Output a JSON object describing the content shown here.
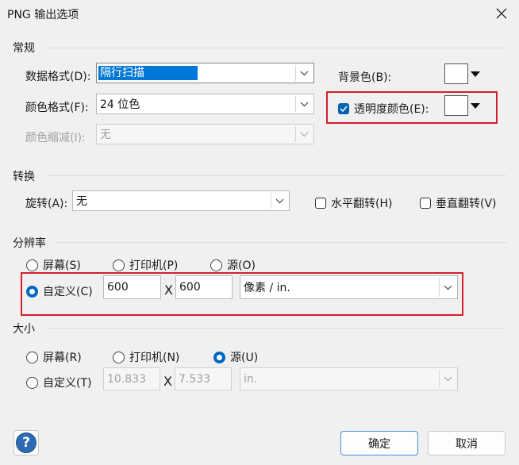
{
  "window": {
    "title": "PNG 输出选项"
  },
  "general": {
    "section": "常规",
    "data_format": {
      "label": "数据格式(D):",
      "value": "隔行扫描"
    },
    "color_format": {
      "label": "颜色格式(F):",
      "value": "24 位色"
    },
    "color_reduce": {
      "label": "颜色缩减(I):",
      "value": "无"
    },
    "background": {
      "label": "背景色(B):",
      "color": "#ffffff"
    },
    "transparent": {
      "label": "透明度颜色(E):",
      "checked": true,
      "color": "#ffffff"
    }
  },
  "transform": {
    "section": "转换",
    "rotate": {
      "label": "旋转(A):",
      "value": "无"
    },
    "flip_h": {
      "label": "水平翻转(H)",
      "checked": false
    },
    "flip_v": {
      "label": "垂直翻转(V)",
      "checked": false
    }
  },
  "resolution": {
    "section": "分辨率",
    "screen": "屏幕(S)",
    "printer": "打印机(P)",
    "source": "源(O)",
    "custom": "自定义(C)",
    "selected": "custom",
    "width": "600",
    "height": "600",
    "x": "X",
    "unit": "像素 / in."
  },
  "size": {
    "section": "大小",
    "screen": "屏幕(R)",
    "printer": "打印机(N)",
    "source": "源(U)",
    "custom": "自定义(T)",
    "selected": "source",
    "width": "10.833",
    "height": "7.533",
    "x": "X",
    "unit": "in."
  },
  "buttons": {
    "ok": "确定",
    "cancel": "取消",
    "help": "?"
  },
  "colors": {
    "highlight": "#0078d7",
    "checkbox": "#0063b1",
    "radio": "#0067c0",
    "red_box": "#d41e2b",
    "help_icon": "#2d6cb5"
  },
  "icons": {
    "close": "close-icon",
    "dropdown": "chevron-down-icon",
    "help": "help-icon"
  }
}
